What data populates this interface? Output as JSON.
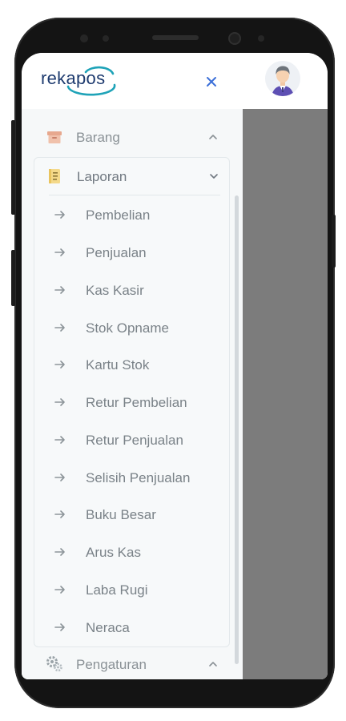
{
  "app": {
    "logo_text": "rekapos",
    "brand_color": "#1e3b6f",
    "accent_color": "#1fa3b8"
  },
  "header": {
    "close_icon": "close-icon",
    "avatar_icon": "user-avatar"
  },
  "menu": {
    "barang": {
      "label": "Barang",
      "icon": "box-icon",
      "state": "expanded-chevron-up"
    },
    "laporan": {
      "label": "Laporan",
      "icon": "report-icon",
      "state": "expanded-chevron-down",
      "items": [
        {
          "label": "Pembelian"
        },
        {
          "label": "Penjualan"
        },
        {
          "label": "Kas Kasir"
        },
        {
          "label": "Stok Opname"
        },
        {
          "label": "Kartu Stok"
        },
        {
          "label": "Retur Pembelian"
        },
        {
          "label": "Retur Penjualan"
        },
        {
          "label": "Selisih Penjualan"
        },
        {
          "label": "Buku Besar"
        },
        {
          "label": "Arus Kas"
        },
        {
          "label": "Laba Rugi"
        },
        {
          "label": "Neraca"
        }
      ]
    },
    "pengaturan": {
      "label": "Pengaturan",
      "icon": "gear-icon",
      "state": "chevron-up"
    }
  }
}
